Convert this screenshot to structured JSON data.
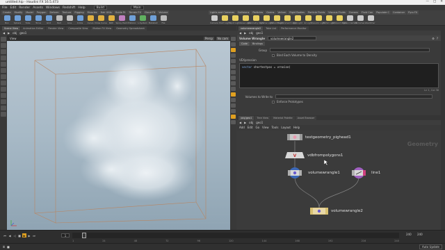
{
  "window": {
    "title": "untitled.hip - Houdini FX 16.5.473"
  },
  "menubar": {
    "items": [
      "File",
      "Edit",
      "Render",
      "Assets",
      "Windows",
      "Redshift",
      "Help"
    ],
    "desktop": "Build",
    "context": "Main"
  },
  "shelf": {
    "tabs": [
      "Create",
      "Modify",
      "Model",
      "Polygon",
      "Deform",
      "Texture",
      "Rigging",
      "Muscles",
      "Hair Utils",
      "Guide Pr",
      "Terrain FX",
      "Cloud FX",
      "Volume"
    ],
    "tools": [
      {
        "label": "Box",
        "color": "#6fa0d8"
      },
      {
        "label": "Sphere",
        "color": "#6fa0d8"
      },
      {
        "label": "Tube",
        "color": "#6fa0d8"
      },
      {
        "label": "Torus",
        "color": "#6fa0d8"
      },
      {
        "label": "Grid",
        "color": "#6fa0d8"
      },
      {
        "label": "Null",
        "color": "#bbbbbb"
      },
      {
        "label": "Line",
        "color": "#c0c0c0"
      },
      {
        "label": "Circle",
        "color": "#6fa0d8"
      },
      {
        "label": "Curve",
        "color": "#e0b040"
      },
      {
        "label": "Draw Curve",
        "color": "#e0b040"
      },
      {
        "label": "Path",
        "color": "#e0b040"
      },
      {
        "label": "Spray Paint",
        "color": "#c080c0"
      },
      {
        "label": "Platonic",
        "color": "#6fa0d8"
      },
      {
        "label": "L-System",
        "color": "#60b060"
      },
      {
        "label": "Metaball",
        "color": "#6fa0d8"
      },
      {
        "label": "File",
        "color": "#bbbbbb"
      }
    ],
    "right_tabs": [
      "Lights and Cameras",
      "Collisions",
      "Particles",
      "Grains",
      "Vellum",
      "Rigid Bodies",
      "Particle Fluids",
      "Viscous Fluids",
      "Oceans",
      "Fluid Con",
      "Populate C",
      "Container",
      "Pyro FX"
    ],
    "right_tools": [
      {
        "label": "Camera",
        "color": "#cccccc"
      },
      {
        "label": "Point Light",
        "color": "#e8d060"
      },
      {
        "label": "Spot Light",
        "color": "#e8d060"
      },
      {
        "label": "Area Light",
        "color": "#e8d060"
      },
      {
        "label": "Geometry Light",
        "color": "#e8d060"
      },
      {
        "label": "Volume Light",
        "color": "#e8d060"
      },
      {
        "label": "Distant Light",
        "color": "#e8d060"
      },
      {
        "label": "Environment Light",
        "color": "#e8d060"
      },
      {
        "label": "Sky Light",
        "color": "#e8d060"
      },
      {
        "label": "GI Light",
        "color": "#e8d060"
      },
      {
        "label": "Caustic Light",
        "color": "#e8d060"
      },
      {
        "label": "Portal Light",
        "color": "#e8d060"
      },
      {
        "label": "Ambient Light",
        "color": "#e8d060"
      },
      {
        "label": "Stereo Camera",
        "color": "#cccccc"
      },
      {
        "label": "VR Camera",
        "color": "#cccccc"
      },
      {
        "label": "Switcher",
        "color": "#cccccc"
      }
    ]
  },
  "left_panel": {
    "tabs": [
      "Scene View",
      "Animation Editor",
      "Render View",
      "Composite View",
      "Motion FX View",
      "Geometry Spreadsheet"
    ],
    "path": [
      "obj",
      "geo1"
    ],
    "view_label": "View",
    "persp": "Persp",
    "cam": "No cam"
  },
  "param_panel": {
    "tabs": [
      "volumewrangle2",
      "Take List",
      "Performance Monitor"
    ],
    "path": [
      "obj",
      "geo1"
    ],
    "node_type": "Volume Wrangle",
    "node_name": "volumewrangle2",
    "subtabs": [
      "Code",
      "Bindings"
    ],
    "group_label": "Group",
    "bind_each_label": "Bind Each Volume to Density",
    "vexpression_label": "VEXpression",
    "code_keyword": "vector",
    "code_rest": " shortestpos = vrnoise(",
    "cursor_pos": "Ln 1, Col 38",
    "volumes_label": "Volumes to Write to",
    "enforce_label": "Enforce Prototypes"
  },
  "network_panel": {
    "tabs": [
      "/obj/geo1",
      "Tree View",
      "Material Palette",
      "Asset Browser"
    ],
    "path": [
      "obj",
      "geo1"
    ],
    "menu": [
      "Add",
      "Edit",
      "Go",
      "View",
      "Tools",
      "Layout",
      "Help"
    ],
    "watermark": "Geometry",
    "nodes": [
      {
        "name": "testgeometry_pighead1",
        "kind": "sop"
      },
      {
        "name": "vdbfrompolygons1",
        "kind": "vdb"
      },
      {
        "name": "volumewrangle1",
        "kind": "wrangle-blue"
      },
      {
        "name": "line1",
        "kind": "line-pink"
      },
      {
        "name": "volumewrangle2",
        "kind": "wrangle-display"
      }
    ]
  },
  "timeline": {
    "frame": "1",
    "start": "1",
    "end": "240",
    "range_end": "240",
    "ticks": [
      "1",
      "24",
      "48",
      "72",
      "96",
      "120",
      "144",
      "168",
      "192",
      "216",
      "240"
    ]
  },
  "statusbar": {
    "auto_update": "Auto Update"
  }
}
